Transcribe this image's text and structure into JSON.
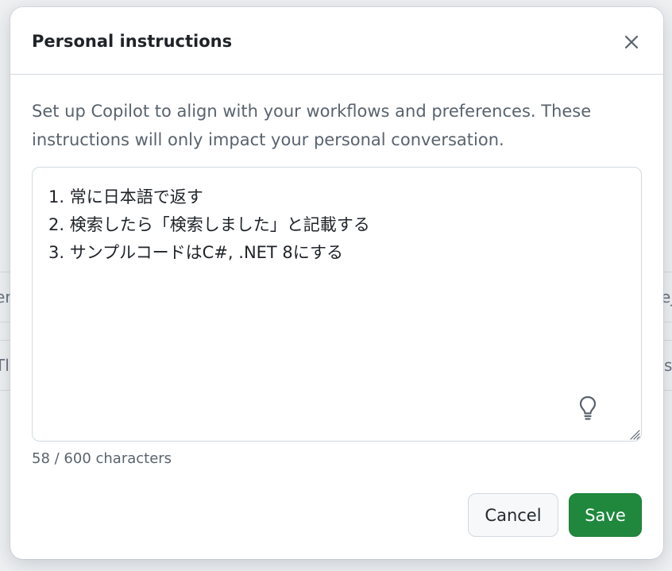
{
  "background": {
    "left_fragments": [
      "er",
      "Tl"
    ],
    "right_fragments": [
      "ej",
      "s"
    ]
  },
  "dialog": {
    "title": "Personal instructions",
    "description": "Set up Copilot to align with your workflows and preferences. These instructions will only impact your personal conversation.",
    "instructions_value": "1. 常に日本語で返す\n2. 検索したら「検索しました」と記載する\n3. サンプルコードはC#, .NET 8にする",
    "character_count": "58 / 600 characters",
    "cancel_label": "Cancel",
    "save_label": "Save"
  },
  "icons": {
    "close": "close-icon",
    "suggestion": "lightbulb-icon",
    "resize": "resize-handle-icon"
  },
  "colors": {
    "save_button": "#1f883d",
    "text_primary": "#1f2328",
    "text_muted": "#59636e"
  }
}
